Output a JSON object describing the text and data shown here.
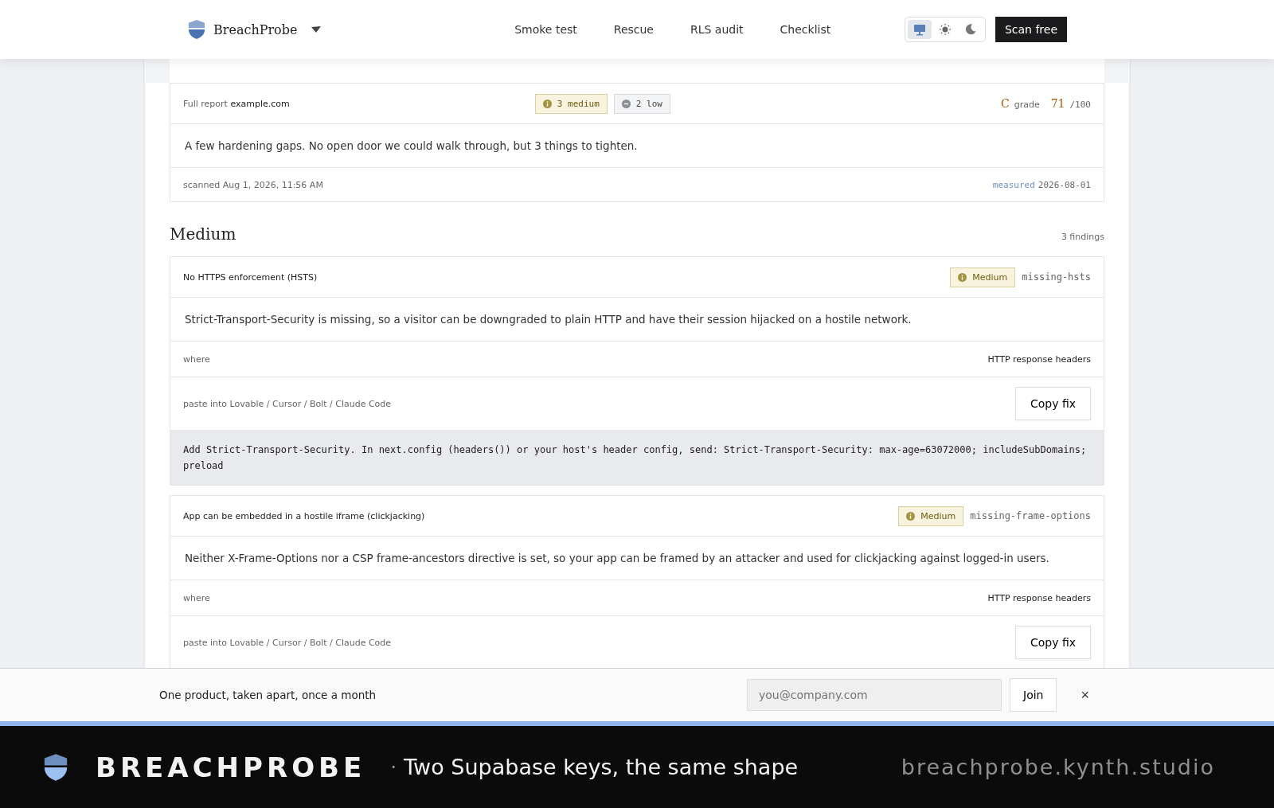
{
  "header": {
    "brand": "BreachProbe",
    "nav": [
      {
        "label": "Smoke test"
      },
      {
        "label": "Rescue"
      },
      {
        "label": "RLS audit"
      },
      {
        "label": "Checklist"
      }
    ],
    "theme_options": [
      {
        "kind": "system",
        "selected": true
      },
      {
        "kind": "light",
        "selected": false
      },
      {
        "kind": "dark",
        "selected": false
      }
    ],
    "cta": "Scan free"
  },
  "report": {
    "label": "Full report",
    "domain": "example.com",
    "badges": [
      {
        "kind": "medium",
        "label": "3 medium"
      },
      {
        "kind": "low",
        "label": "2 low"
      }
    ],
    "grade": "C",
    "grade_label": "grade",
    "score": "71",
    "score_max": "/100",
    "summary": "A few hardening gaps. No open door we could walk through, but 3 things to tighten.",
    "scanned": "scanned Aug 1, 2026, 11:56 AM",
    "measured_label": "measured",
    "measured_date": "2026-08-01"
  },
  "section": {
    "title": "Medium",
    "count": "3 findings"
  },
  "findings": [
    {
      "title": "No HTTPS enforcement (HSTS)",
      "severity": "Medium",
      "code": "missing-hsts",
      "description": "Strict-Transport-Security is missing, so a visitor can be downgraded to plain HTTP and have their session hijacked on a hostile network.",
      "where_label": "where",
      "where": "HTTP response headers",
      "paste_label": "paste into Lovable / Cursor / Bolt / Claude Code",
      "copy": "Copy fix",
      "fix": "Add Strict-Transport-Security. In next.config (headers()) or your host's header config, send: Strict-Transport-Security: max-age=63072000; includeSubDomains; preload"
    },
    {
      "title": "App can be embedded in a hostile iframe (clickjacking)",
      "severity": "Medium",
      "code": "missing-frame-options",
      "description": "Neither X-Frame-Options nor a CSP frame-ancestors directive is set, so your app can be framed by an attacker and used for clickjacking against logged-in users.",
      "where_label": "where",
      "where": "HTTP response headers",
      "paste_label": "paste into Lovable / Cursor / Bolt / Claude Code",
      "copy": "Copy fix"
    }
  ],
  "newsletter": {
    "text": "One product, taken apart, once a month",
    "placeholder": "you@company.com",
    "button": "Join",
    "close": "×"
  },
  "banner": {
    "brand": "BREACHPROBE",
    "bullet": "•",
    "tagline": "Two Supabase keys, the same shape",
    "url": "breachprobe.kynth.studio"
  }
}
